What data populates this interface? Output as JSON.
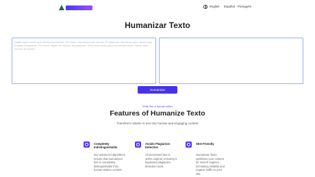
{
  "header": {
    "languages": [
      "English",
      "Español",
      "Português"
    ],
    "brand_color": "#4a3aff"
  },
  "main": {
    "title": "Humanizar Texto",
    "input_placeholder": "Digite aqui o texto que deseja humanizar. Por favor, introduza pelo menos 30 palavras. Introduza pelo menos que desejar humanizar. Por favor, digite no mínimo 30 palavras. Texto bem mais para humanizar texto. Insere pelo menos 30 words.",
    "button_label": "Humanizar"
  },
  "features": {
    "eyebrow": "Write like a human writer",
    "title": "Features of Humanize Texto",
    "subtitle": "Transform robotic AI text into human and engaging content",
    "items": [
      {
        "title": "Completely Indistinguishable",
        "body": "Our advanced algorithms ensure that humanized text is completely distinguishable from human-written content."
      },
      {
        "title": "Avoids Plagiarism Detection",
        "body": "All processed text is 100% original, ensuring it bypasses plagiarism detection tools."
      },
      {
        "title": "SEO-Friendly",
        "body": "Humanizar Texto optimizes your content for search engines, increasing visibility and organic traffic to your site."
      }
    ]
  }
}
